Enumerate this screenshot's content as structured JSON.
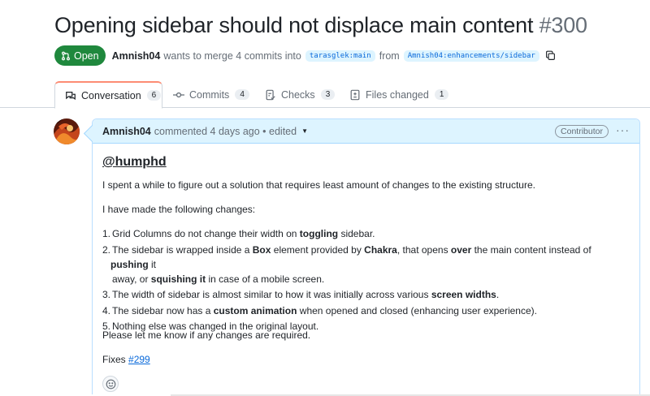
{
  "pr": {
    "title": "Opening sidebar should not displace main content",
    "number": "#300",
    "state": "Open",
    "author": "Amnish04",
    "merge_text": "wants to merge 4 commits into",
    "base_branch": "tarasglek:main",
    "from_text": "from",
    "head_branch": "Amnish04:enhancements/sidebar"
  },
  "tabs": [
    {
      "label": "Conversation",
      "count": "6",
      "icon": "conversation-icon"
    },
    {
      "label": "Commits",
      "count": "4",
      "icon": "commit-icon"
    },
    {
      "label": "Checks",
      "count": "3",
      "icon": "checks-icon"
    },
    {
      "label": "Files changed",
      "count": "1",
      "icon": "file-diff-icon"
    }
  ],
  "comment": {
    "author": "Amnish04",
    "meta": "commented 4 days ago • edited",
    "badge": "Contributor",
    "mention": "@humphd",
    "intro": "I spent a while to figure out a solution that requires least amount of changes to the existing structure.",
    "changes_heading": "I have made the following changes:",
    "changes": [
      {
        "num": "1.",
        "a": "Grid Columns do not change their width on ",
        "b1": "toggling",
        "c": " sidebar."
      },
      {
        "num": "2.",
        "a": "The sidebar is wrapped inside a ",
        "b1": "Box",
        "c": " element provided by ",
        "b2": "Chakra",
        "d": ", that opens ",
        "b3": "over",
        "e": " the main content instead of ",
        "b4": "pushing",
        "f": " it",
        "line2a": "away, or ",
        "b5": "squishing it",
        "line2b": " in case of a mobile screen."
      },
      {
        "num": "3.",
        "a": "The width of sidebar is almost similar to how it was initially across various ",
        "b1": "screen widths",
        "c": "."
      },
      {
        "num": "4.",
        "a": "The sidebar now has a ",
        "b1": "custom animation",
        "c": " when opened and closed (enhancing user experience)."
      },
      {
        "num": "5.",
        "a": "Nothing else was changed in the original layout."
      }
    ],
    "closing": "Please let me know if any changes are required.",
    "fixes_label": "Fixes",
    "fixes_issue": "#299"
  },
  "colors": {
    "open_green": "#1f883d",
    "link_blue": "#0969da",
    "header_blue": "#ddf4ff",
    "tab_accent": "#fd8c73"
  }
}
